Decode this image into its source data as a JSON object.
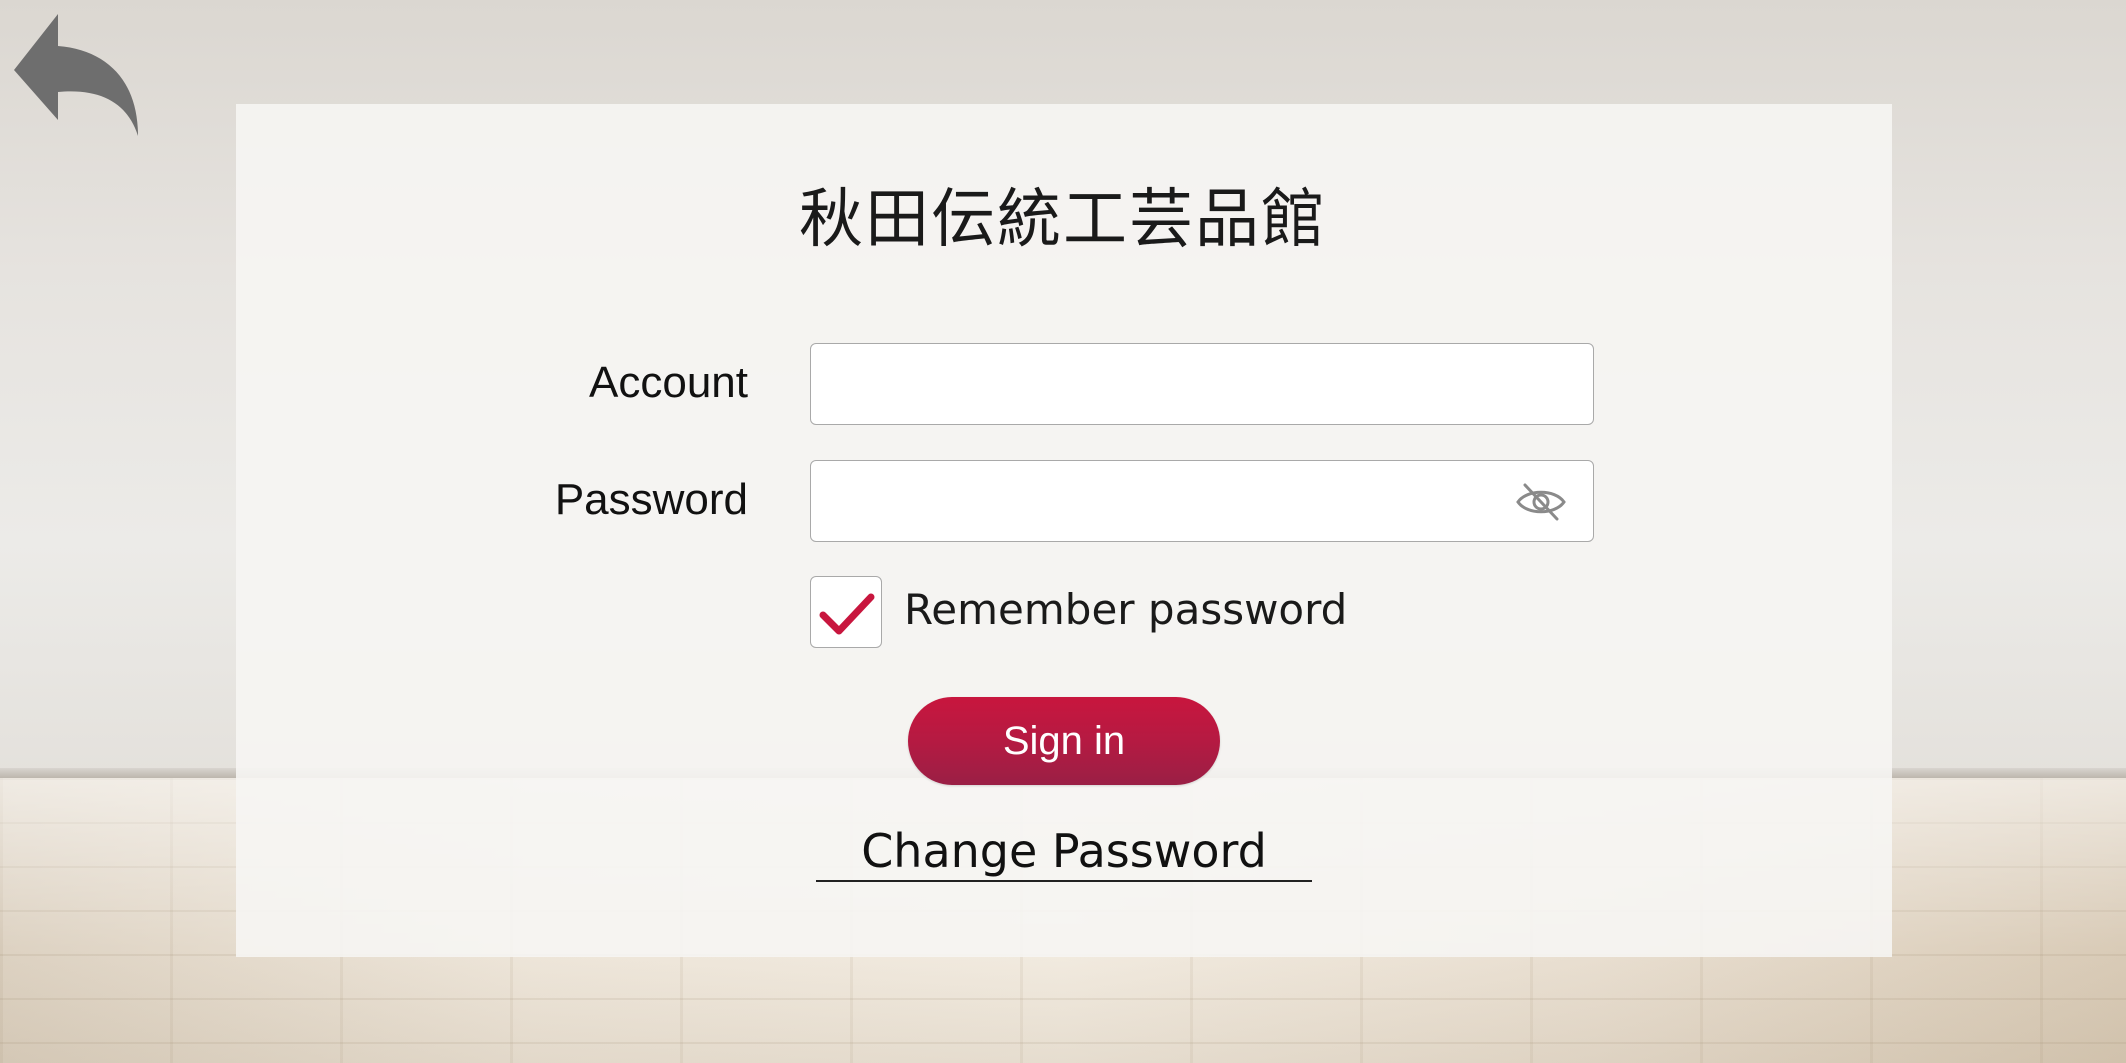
{
  "app": {
    "title": "秋田伝統工芸品館"
  },
  "nav": {
    "back_icon": "back-arrow-icon"
  },
  "form": {
    "account_label": "Account",
    "account_value": "",
    "account_placeholder": "",
    "password_label": "Password",
    "password_value": "",
    "password_placeholder": "",
    "password_toggle_icon": "eye-slash-icon",
    "remember_label": "Remember password",
    "remember_checked": true,
    "signin_label": "Sign in",
    "change_password_label": "Change Password"
  },
  "colors": {
    "accent": "#b51a42",
    "checkmark": "#c8163e",
    "back_icon": "#6e6e6e"
  }
}
